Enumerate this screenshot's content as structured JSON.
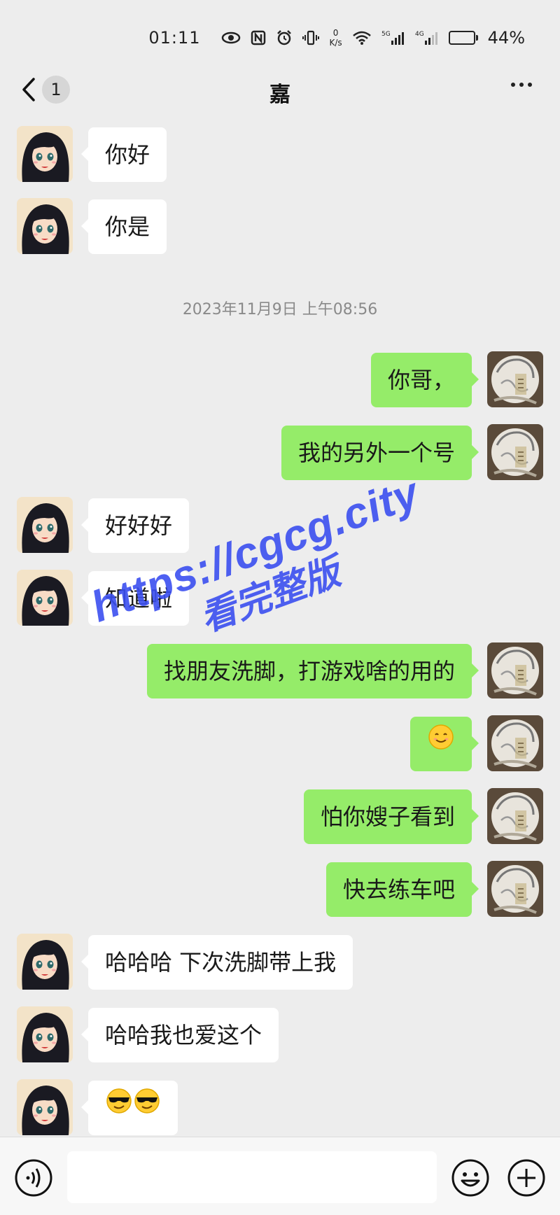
{
  "status_bar": {
    "time": "01:11",
    "net_speed_value": "0",
    "net_speed_unit": "K/s",
    "signal_5g": "5G",
    "signal_4g": "4G",
    "battery_percent_label": "44%",
    "battery_level": 0.44
  },
  "header": {
    "unread_count": "1",
    "title": "嘉"
  },
  "timestamp": "2023年11月9日 上午08:56",
  "messages": [
    {
      "side": "in",
      "text": "你好"
    },
    {
      "side": "in",
      "text": "你是"
    },
    {
      "side": "out",
      "text": "你哥，"
    },
    {
      "side": "out",
      "text": "我的另外一个号"
    },
    {
      "side": "in",
      "text": "好好好"
    },
    {
      "side": "in",
      "text": "知道啦"
    },
    {
      "side": "out",
      "text": "找朋友洗脚，打游戏啥的用的"
    },
    {
      "side": "out",
      "text": "",
      "emoji": "smile-emoji"
    },
    {
      "side": "out",
      "text": "怕你嫂子看到"
    },
    {
      "side": "out",
      "text": "快去练车吧"
    },
    {
      "side": "in",
      "text": "哈哈哈 下次洗脚带上我"
    },
    {
      "side": "in",
      "text": "哈哈我也爱这个"
    },
    {
      "side": "in",
      "text": "",
      "emoji": "sunglasses-emoji-x2"
    }
  ],
  "watermark": {
    "url": "https://cgcg.city",
    "subtitle": "看完整版"
  },
  "input_bar": {
    "placeholder": ""
  },
  "colors": {
    "background": "#ededed",
    "incoming_bubble": "#ffffff",
    "outgoing_bubble": "#95ec69",
    "watermark": "#3b4ff0"
  }
}
